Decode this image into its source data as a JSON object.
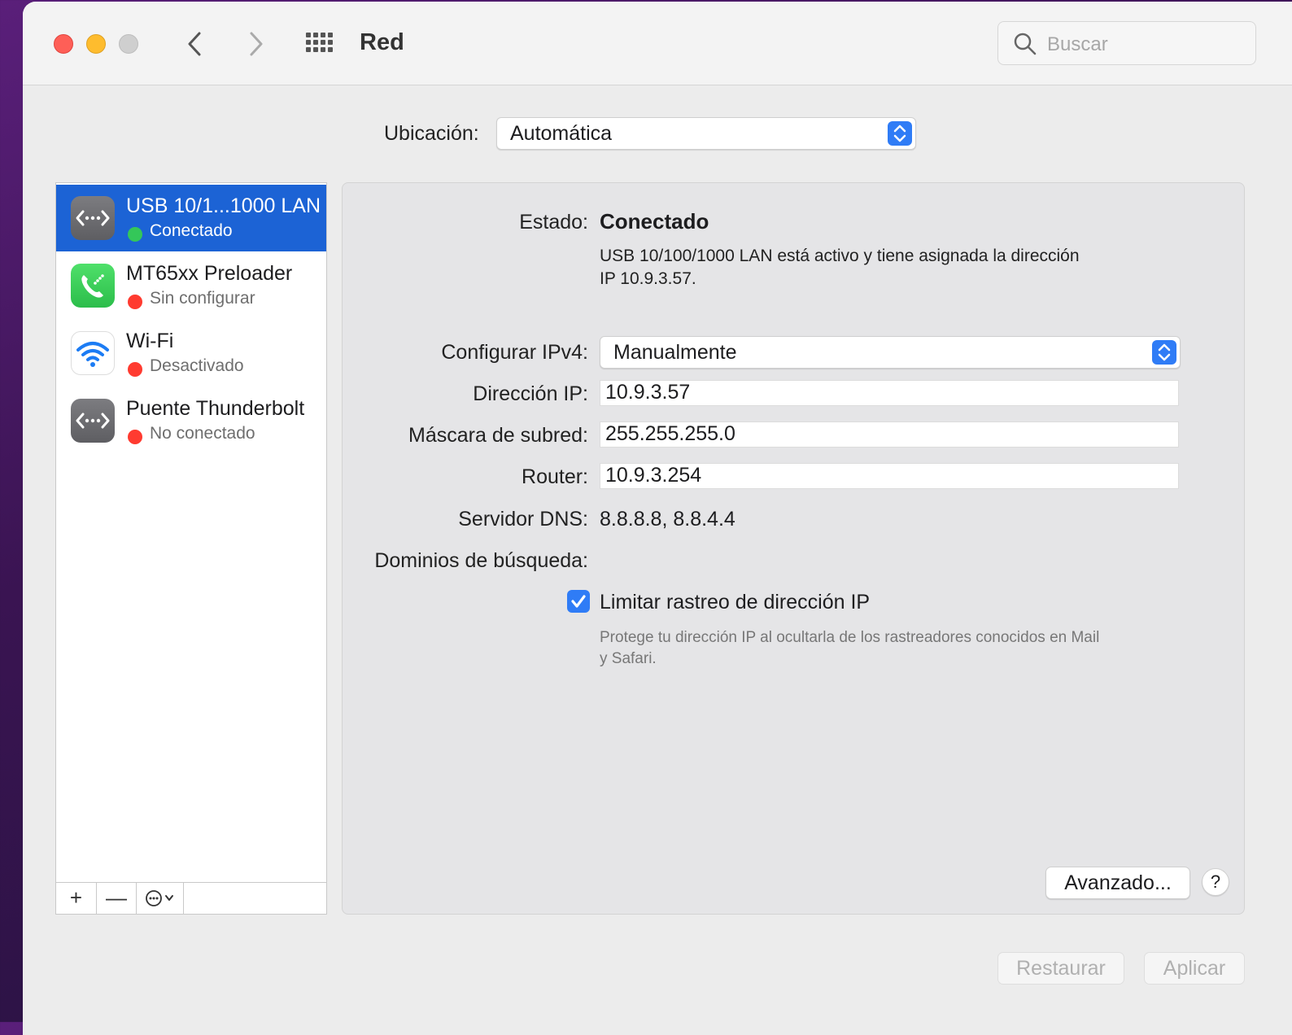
{
  "window": {
    "title": "Red",
    "search_placeholder": "Buscar"
  },
  "location": {
    "label": "Ubicación:",
    "value": "Automática"
  },
  "services": [
    {
      "name": "USB 10/1...1000 LAN",
      "status": "Conectado",
      "status_color": "#34c759",
      "icon": "ethernet-icon",
      "selected": true
    },
    {
      "name": "MT65xx Preloader",
      "status": "Sin configurar",
      "status_color": "#ff3b30",
      "icon": "phone-modem-icon",
      "selected": false
    },
    {
      "name": "Wi-Fi",
      "status": "Desactivado",
      "status_color": "#ff3b30",
      "icon": "wifi-icon",
      "selected": false
    },
    {
      "name": "Puente Thunderbolt",
      "status": "No conectado",
      "status_color": "#ff3b30",
      "icon": "ethernet-icon",
      "selected": false
    }
  ],
  "sidebar_toolbar": {
    "add": "+",
    "remove": "—"
  },
  "detail": {
    "status_label": "Estado:",
    "status_value": "Conectado",
    "status_desc_line1": "USB 10/100/1000 LAN está activo y tiene asignada la dirección",
    "status_desc_line2": "IP 10.9.3.57.",
    "configure_label": "Configurar IPv4:",
    "configure_value": "Manualmente",
    "ip_label": "Dirección IP:",
    "ip_value": "10.9.3.57",
    "mask_label": "Máscara de subred:",
    "mask_value": "255.255.255.0",
    "router_label": "Router:",
    "router_value": "10.9.3.254",
    "dns_label": "Servidor DNS:",
    "dns_value": "8.8.8.8, 8.8.4.4",
    "domains_label": "Dominios de búsqueda:",
    "limit_tracking_label": "Limitar rastreo de dirección IP",
    "limit_tracking_checked": true,
    "limit_tracking_desc_line1": "Protege tu dirección IP al ocultarla de los rastreadores conocidos en Mail",
    "limit_tracking_desc_line2": "y Safari.",
    "advanced_button": "Avanzado...",
    "help_button": "?"
  },
  "footer": {
    "revert_button": "Restaurar",
    "apply_button": "Aplicar"
  },
  "colors": {
    "accent": "#2f7cf6",
    "selection": "#1c63d5"
  }
}
